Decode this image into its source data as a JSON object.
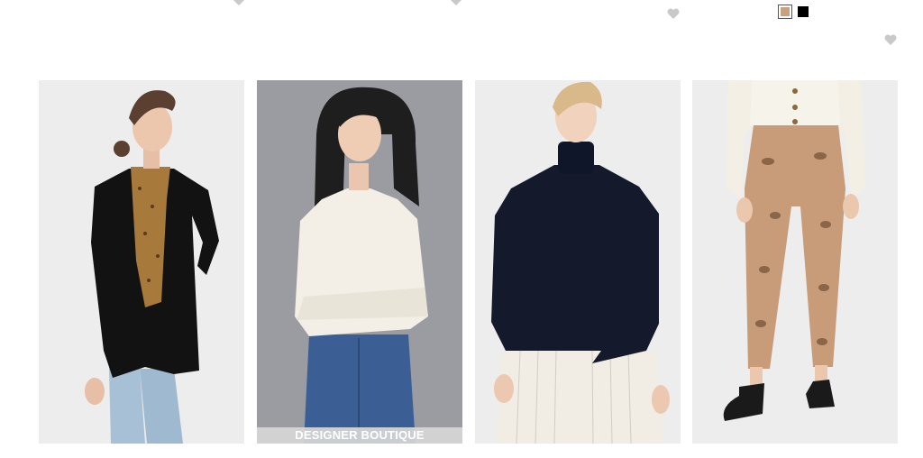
{
  "previous_row": {
    "hearts": [
      "favorite",
      "favorite",
      "favorite",
      "favorite"
    ],
    "swatches": [
      {
        "name": "tan snake",
        "color": "#c9a17f",
        "selected": true
      },
      {
        "name": "black",
        "color": "#000000",
        "selected": false
      }
    ]
  },
  "products": [
    {
      "name": "black blazer with leopard print blouse",
      "badge": ""
    },
    {
      "name": "ivory crew neck sweater",
      "badge": "DESIGNER BOUTIQUE"
    },
    {
      "name": "navy turtleneck sweater",
      "badge": ""
    },
    {
      "name": "snake print skinny pants",
      "badge": ""
    }
  ],
  "colors": {
    "heart": "#c9c9c9",
    "badge_bg": "#d7d7d7",
    "badge_text": "#ffffff"
  }
}
